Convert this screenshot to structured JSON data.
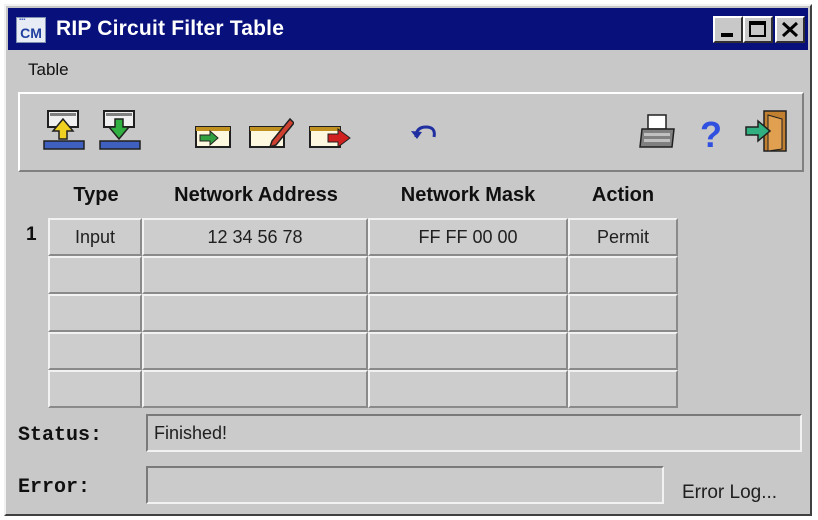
{
  "window": {
    "title": "RIP Circuit Filter Table",
    "app_icon_label": "CM"
  },
  "menu": {
    "items": [
      "Table"
    ]
  },
  "toolbar": {
    "icons": [
      "import-icon",
      "export-icon",
      "add-record-icon",
      "edit-record-icon",
      "delete-record-icon",
      "undo-icon",
      "print-icon",
      "help-icon",
      "exit-icon"
    ]
  },
  "table": {
    "columns": [
      "Type",
      "Network Address",
      "Network Mask",
      "Action"
    ],
    "rows": [
      {
        "num": "1",
        "type": "Input",
        "address": "12 34 56 78",
        "mask": "FF FF 00 00",
        "action": "Permit"
      },
      {
        "num": "",
        "type": "",
        "address": "",
        "mask": "",
        "action": ""
      },
      {
        "num": "",
        "type": "",
        "address": "",
        "mask": "",
        "action": ""
      },
      {
        "num": "",
        "type": "",
        "address": "",
        "mask": "",
        "action": ""
      },
      {
        "num": "",
        "type": "",
        "address": "",
        "mask": "",
        "action": ""
      }
    ]
  },
  "status": {
    "label": "Status:",
    "value": "Finished!"
  },
  "error": {
    "label": "Error:",
    "value": "",
    "log_link": "Error Log..."
  },
  "colors": {
    "titlebar": "#08107c",
    "face": "#c8c8c8"
  }
}
